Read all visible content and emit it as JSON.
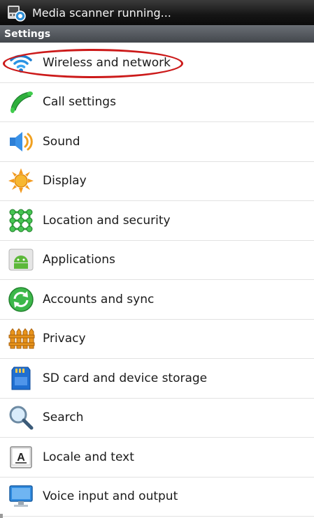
{
  "status_bar": {
    "notification_text": "Media scanner running...",
    "notification_icon": "media-scanner-icon"
  },
  "title_bar": {
    "title": "Settings"
  },
  "menu": {
    "items": [
      {
        "label": "Wireless and network",
        "icon": "wifi-icon",
        "highlighted": true
      },
      {
        "label": "Call settings",
        "icon": "phone-icon"
      },
      {
        "label": "Sound",
        "icon": "speaker-icon"
      },
      {
        "label": "Display",
        "icon": "sun-icon"
      },
      {
        "label": "Location and security",
        "icon": "location-grid-icon"
      },
      {
        "label": "Applications",
        "icon": "android-icon"
      },
      {
        "label": "Accounts and sync",
        "icon": "sync-icon"
      },
      {
        "label": "Privacy",
        "icon": "fence-icon"
      },
      {
        "label": "SD card and device storage",
        "icon": "sd-card-icon"
      },
      {
        "label": "Search",
        "icon": "magnifier-icon"
      },
      {
        "label": "Locale and text",
        "icon": "keyboard-key-icon"
      },
      {
        "label": "Voice input and output",
        "icon": "monitor-icon"
      }
    ]
  },
  "annotation": {
    "highlight_color": "#cc1a1a"
  }
}
